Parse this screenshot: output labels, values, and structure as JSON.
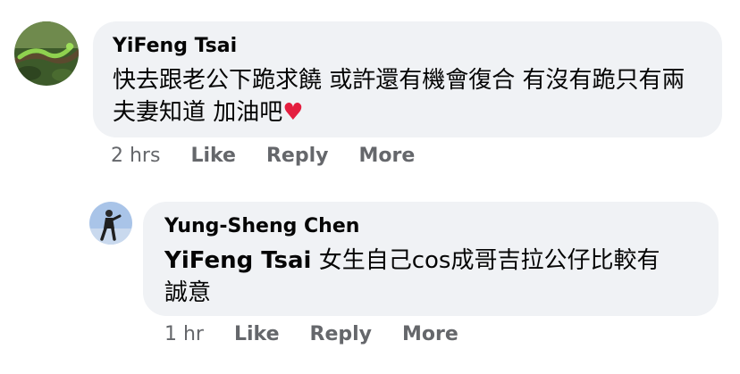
{
  "comments": [
    {
      "author": "YiFeng Tsai",
      "avatar_icon": "snake-on-branch-avatar",
      "text": "快去跟老公下跪求饒 或許還有機會復合 有沒有跪只有兩夫妻知道 加油吧",
      "emoji": "♥",
      "emoji_name": "red-heart-icon",
      "timestamp": "2 hrs",
      "actions": {
        "like": "Like",
        "reply": "Reply",
        "more": "More"
      }
    },
    {
      "author": "Yung-Sheng Chen",
      "avatar_icon": "person-standing-avatar",
      "mention": "YiFeng Tsai",
      "text": "女生自己cos成哥吉拉公仔比較有誠意",
      "timestamp": "1 hr",
      "actions": {
        "like": "Like",
        "reply": "Reply",
        "more": "More"
      }
    }
  ],
  "colors": {
    "bubble_bg": "#f0f2f5",
    "secondary_text": "#65676b",
    "primary_text": "#050505",
    "heart": "#e41e3f"
  }
}
